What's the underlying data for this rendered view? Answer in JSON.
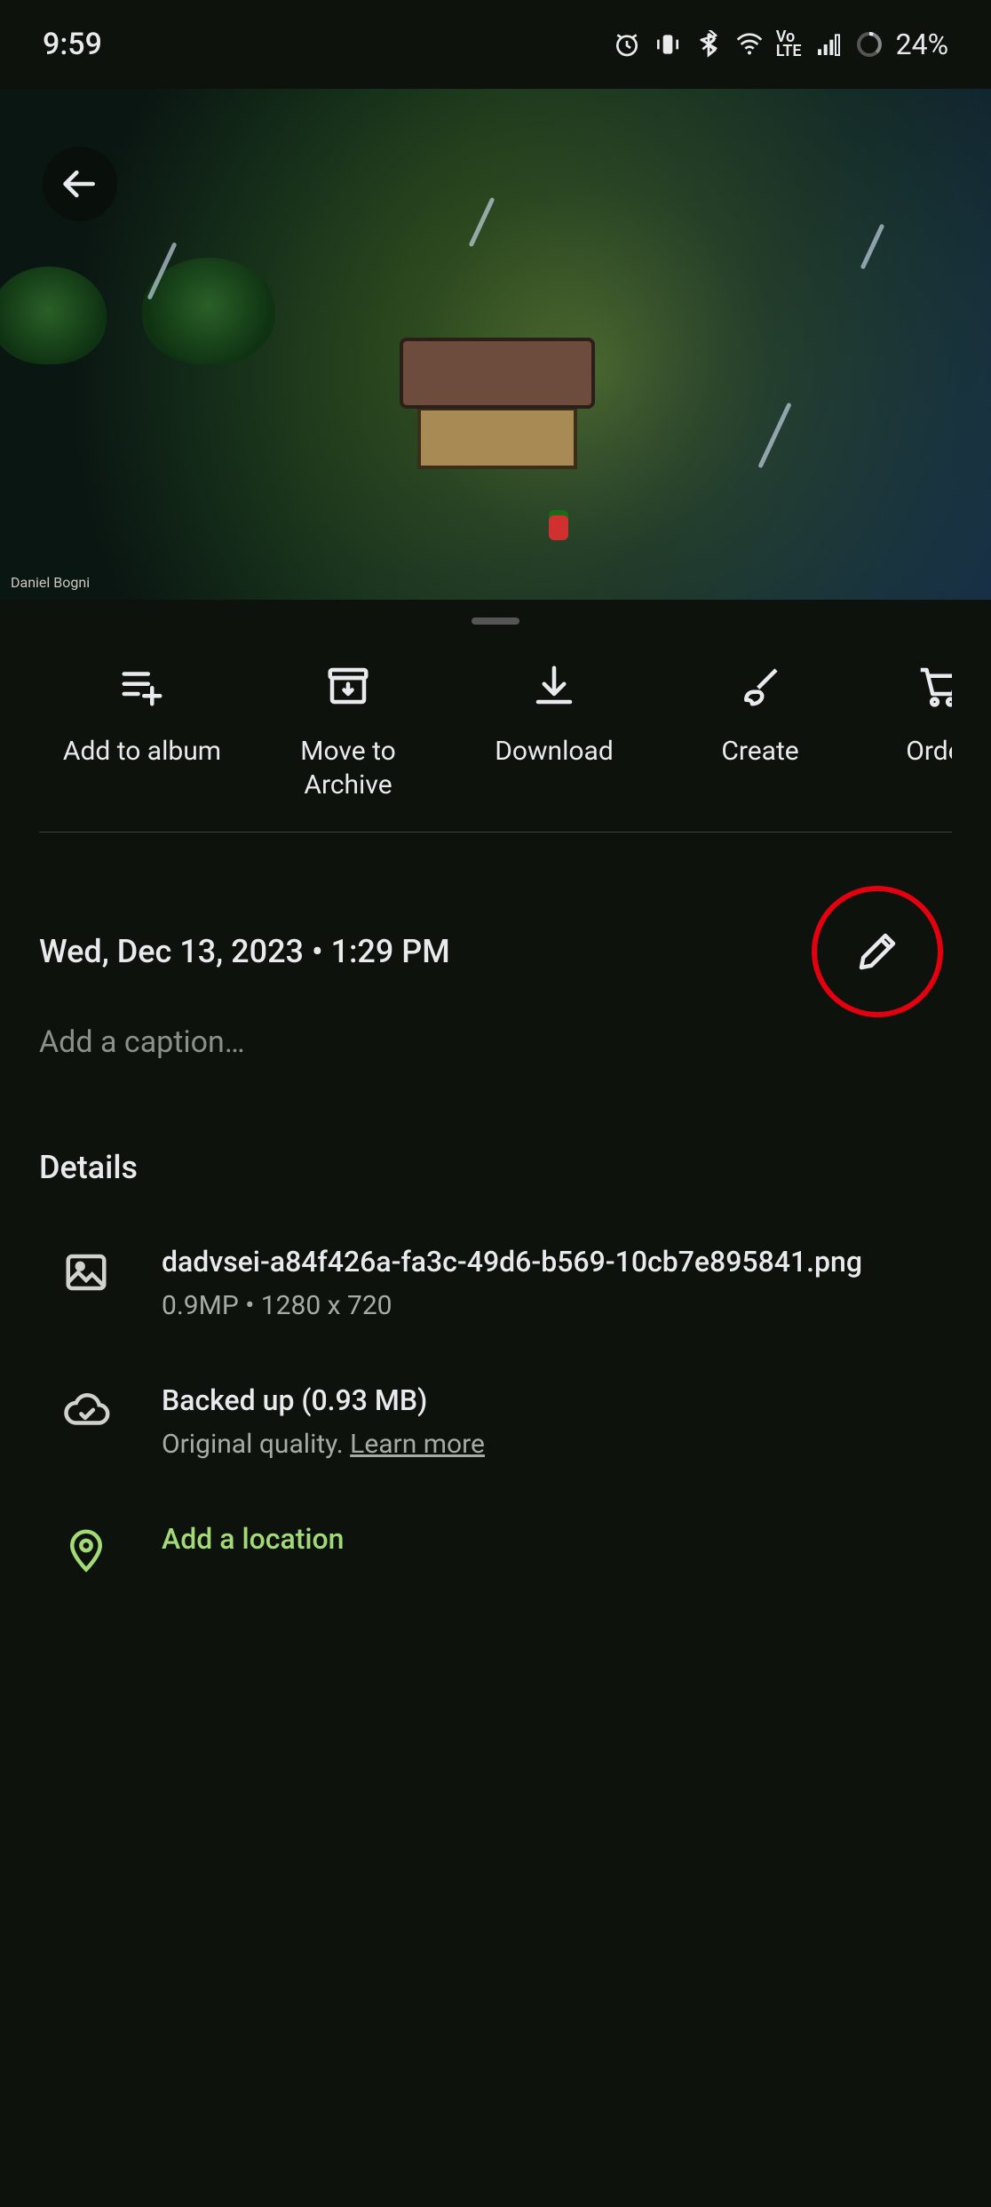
{
  "status_bar": {
    "time": "9:59",
    "volte": "Vo\nLTE",
    "battery_percent": "24%"
  },
  "hero": {
    "artist_credit": "Daniel Bogni"
  },
  "actions": [
    {
      "id": "add-to-album",
      "label": "Add to album"
    },
    {
      "id": "archive",
      "label": "Move to\nArchive"
    },
    {
      "id": "download",
      "label": "Download"
    },
    {
      "id": "create",
      "label": "Create"
    },
    {
      "id": "order",
      "label": "Order"
    }
  ],
  "meta": {
    "datetime": "Wed, Dec 13, 2023  •  1:29 PM"
  },
  "caption": {
    "placeholder": "Add a caption…"
  },
  "details": {
    "heading": "Details",
    "file": {
      "name": "dadvsei-a84f426a-fa3c-49d6-b569-10cb7e895841.png",
      "meta": "0.9MP  •  1280 x 720"
    },
    "backup": {
      "status": "Backed up (0.93 MB)",
      "quality_prefix": "Original quality. ",
      "learn_more": "Learn more"
    },
    "location": {
      "add_label": "Add a location"
    }
  }
}
